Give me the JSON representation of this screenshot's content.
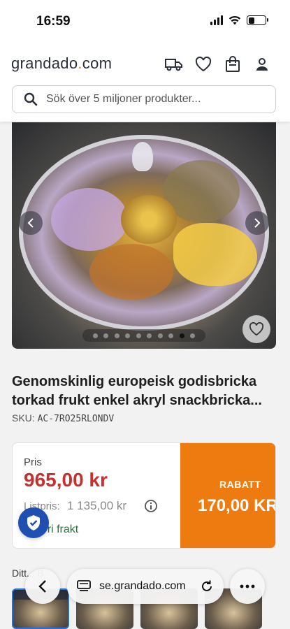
{
  "status_bar": {
    "time": "16:59"
  },
  "header": {
    "logo_text": "grandado",
    "logo_dot": ".",
    "logo_tld": "com",
    "icons": [
      "truck-icon",
      "heart-icon",
      "bag-icon",
      "user-icon"
    ]
  },
  "search": {
    "placeholder": "Sök över 5 miljoner produkter..."
  },
  "gallery": {
    "total_images": 10,
    "active_index": 9
  },
  "product": {
    "title": "Genomskinlig europeisk godisbricka torkad frukt enkel akryl snackbricka...",
    "sku_label": "SKU:",
    "sku_value": "AC-7RO25RLONDV"
  },
  "price_box": {
    "price_label": "Pris",
    "price": "965,00 kr",
    "list_label": "Listpris:",
    "list_price": "1 135,00 kr",
    "shipping": "Fri frakt",
    "discount_label": "RABATT",
    "discount_value": "170,00 KR"
  },
  "recommendations": {
    "title": "Ditt... B"
  },
  "browser": {
    "url": "se.grandado.com"
  },
  "colors": {
    "discount_bg": "#ee7b10",
    "price_red": "#c53030",
    "shipping_green": "#1f7a3a",
    "brand_dot": "#ef7d00"
  }
}
